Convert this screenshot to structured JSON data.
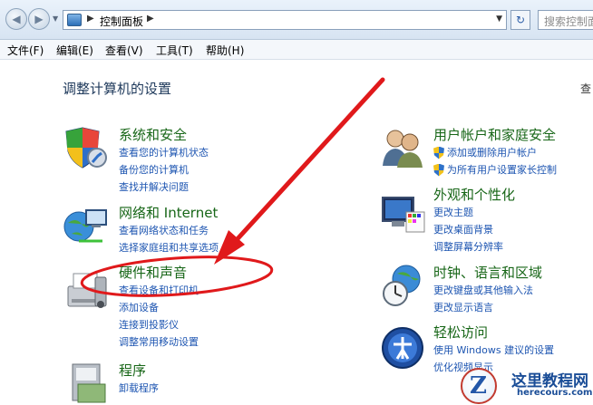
{
  "address": {
    "path": "控制面板",
    "search_placeholder": "搜索控制面"
  },
  "menu": [
    "文件(F)",
    "编辑(E)",
    "查看(V)",
    "工具(T)",
    "帮助(H)"
  ],
  "heading": "调整计算机的设置",
  "corner_letter": "查",
  "categories": [
    {
      "title": "系统和安全",
      "links": [
        "查看您的计算机状态",
        "备份您的计算机",
        "查找并解决问题"
      ]
    },
    {
      "title": "网络和 Internet",
      "links": [
        "查看网络状态和任务",
        "选择家庭组和共享选项"
      ]
    },
    {
      "title": "硬件和声音",
      "links": [
        "查看设备和打印机",
        "添加设备",
        "连接到投影仪",
        "调整常用移动设置"
      ]
    },
    {
      "title": "程序",
      "links": [
        "卸载程序"
      ]
    },
    {
      "title": "用户帐户和家庭安全",
      "links": [
        "添加或删除用户帐户",
        "为所有用户设置家长控制"
      ]
    },
    {
      "title": "外观和个性化",
      "links": [
        "更改主题",
        "更改桌面背景",
        "调整屏幕分辨率"
      ]
    },
    {
      "title": "时钟、语言和区域",
      "links": [
        "更改键盘或其他输入法",
        "更改显示语言"
      ]
    },
    {
      "title": "轻松访问",
      "links": [
        "使用 Windows 建议的设置",
        "优化视频显示"
      ]
    }
  ],
  "watermark": {
    "name": "这里教程网",
    "url": "herecours.com"
  },
  "colors": {
    "category_title": "#176617",
    "link": "#1d55b1",
    "annotation": "#e0191b"
  }
}
